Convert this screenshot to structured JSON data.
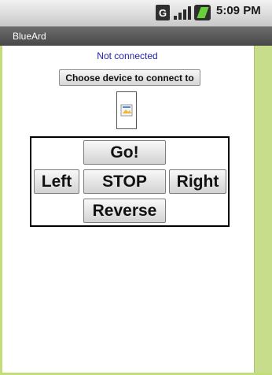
{
  "status_bar": {
    "time": "5:09 PM",
    "icons": [
      "g-network-icon",
      "signal-icon",
      "battery-icon"
    ],
    "g_label": "G"
  },
  "app": {
    "title": "BlueArd"
  },
  "connection": {
    "status": "Not connected",
    "choose_label": "Choose device to connect to"
  },
  "controls": {
    "go": "Go!",
    "left": "Left",
    "stop": "STOP",
    "right": "Right",
    "reverse": "Reverse"
  },
  "colors": {
    "status_text": "#2222aa",
    "frame_accent": "#c3de78",
    "titlebar": "#555555"
  }
}
